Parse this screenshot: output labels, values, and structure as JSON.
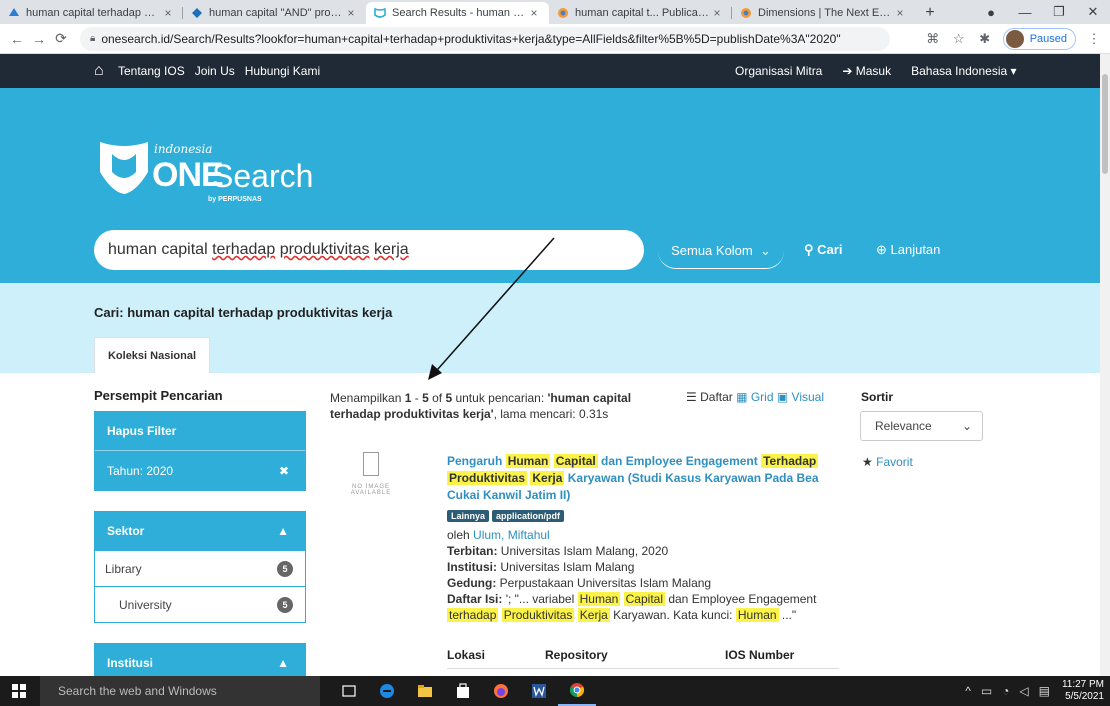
{
  "browser": {
    "tabs": [
      {
        "label": "human capital terhadap prod",
        "icon": "blue-drop-icon",
        "active": false
      },
      {
        "label": "human capital \"AND\" produk",
        "icon": "diamond-icon",
        "active": false
      },
      {
        "label": "Search Results - human capit",
        "icon": "onesearch-icon",
        "active": true
      },
      {
        "label": "human capital t... Publication",
        "icon": "dimensions-icon",
        "active": false
      },
      {
        "label": "Dimensions | The Next Evolut",
        "icon": "dimensions-icon",
        "active": false
      }
    ],
    "close_glyph": "×",
    "new_tab": "+",
    "url": "onesearch.id/Search/Results?lookfor=human+capital+terhadap+produktivitas+kerja&type=AllFields&filter%5B%5D=publishDate%3A\"2020\"",
    "profile_label": "Paused"
  },
  "topnav": {
    "links_left": [
      "Tentang IOS",
      "Join Us",
      "Hubungi Kami"
    ],
    "links_right": [
      "Organisasi Mitra",
      "Masuk",
      "Bahasa Indonesia"
    ]
  },
  "logo": {
    "indonesia": "indonesia",
    "one": "ONE",
    "search": "Search",
    "by": "by PERPUSNAS"
  },
  "search": {
    "query_plain": "human capital ",
    "query_words_underlined": [
      "terhadap",
      "produktivitas",
      "kerja"
    ],
    "scope": "Semua Kolom",
    "submit": "Cari",
    "advanced": "Lanjutan"
  },
  "band": {
    "query_heading": "Cari: human capital terhadap produktivitas kerja",
    "collection_tab": "Koleksi Nasional"
  },
  "sidebar": {
    "title": "Persempit Pencarian",
    "clear_filter": "Hapus Filter",
    "active_filter": "Tahun: 2020",
    "groups": [
      {
        "label": "Sektor",
        "options": [
          {
            "label": "Library",
            "count": "5",
            "sub": false
          },
          {
            "label": "University",
            "count": "5",
            "sub": true
          }
        ]
      },
      {
        "label": "Institusi",
        "options": []
      }
    ]
  },
  "results": {
    "meta_prefix": "Menampilkan ",
    "meta_from": "1",
    "meta_dash": " - ",
    "meta_to": "5",
    "meta_of": " of ",
    "meta_total": "5",
    "meta_for": " untuk pencarian: ",
    "meta_query": "'human capital terhadap produktivitas kerja'",
    "meta_time": ", lama mencari: 0.31s",
    "views": [
      "Daftar",
      "Grid",
      "Visual"
    ],
    "sort_label": "Sortir",
    "sort_value": "Relevance",
    "favorite": "Favorit",
    "no_image_1": "NO IMAGE",
    "no_image_2": "AVAILABLE",
    "item": {
      "title_parts": [
        {
          "t": "Pengaruh ",
          "hl": false
        },
        {
          "t": "Human",
          "hl": true
        },
        {
          "t": " ",
          "hl": false
        },
        {
          "t": "Capital",
          "hl": true
        },
        {
          "t": " dan Employee Engagement ",
          "hl": false
        },
        {
          "t": "Terhadap",
          "hl": true
        },
        {
          "t": " ",
          "hl": false
        },
        {
          "t": "Produktivitas",
          "hl": true
        },
        {
          "t": " ",
          "hl": false
        },
        {
          "t": "Kerja",
          "hl": true
        },
        {
          "t": " Karyawan (Studi Kasus Karyawan Pada Bea Cukai Kanwil Jatim II)",
          "hl": false
        }
      ],
      "tags": [
        "Lainnya",
        "application/pdf"
      ],
      "by_label": "oleh ",
      "author": "Ulum, Miftahul",
      "terbitan_label": "Terbitan:",
      "terbitan": " Universitas Islam Malang, 2020",
      "institusi_label": "Institusi:",
      "institusi": " Universitas Islam Malang",
      "gedung_label": "Gedung:",
      "gedung": " Perpustakaan Universitas Islam Malang",
      "daftar_label": "Daftar Isi:",
      "daftar_parts": [
        {
          "t": " '; \"... variabel ",
          "hl": false
        },
        {
          "t": "Human",
          "hl": true
        },
        {
          "t": " ",
          "hl": false
        },
        {
          "t": "Capital",
          "hl": true
        },
        {
          "t": " dan Employee Engagement ",
          "hl": false
        },
        {
          "t": "terhadap",
          "hl": true
        },
        {
          "t": " ",
          "hl": false
        },
        {
          "t": "Produktivitas",
          "hl": true
        },
        {
          "t": " ",
          "hl": false
        },
        {
          "t": "Kerja",
          "hl": true
        },
        {
          "t": " Karyawan. Kata kunci: ",
          "hl": false
        },
        {
          "t": "Human",
          "hl": true
        },
        {
          "t": " ...\"",
          "hl": false
        }
      ],
      "table_headers": [
        "Lokasi",
        "Repository",
        "IOS Number"
      ]
    }
  },
  "taskbar": {
    "search_placeholder": "Search the web and Windows",
    "time": "11:27 PM",
    "date": "5/5/2021"
  },
  "colors": {
    "nav": "#1f2a36",
    "brand": "#2eaed8",
    "band": "#cdf0fb",
    "link": "#2f8fbf",
    "highlight": "#fbf34a"
  }
}
